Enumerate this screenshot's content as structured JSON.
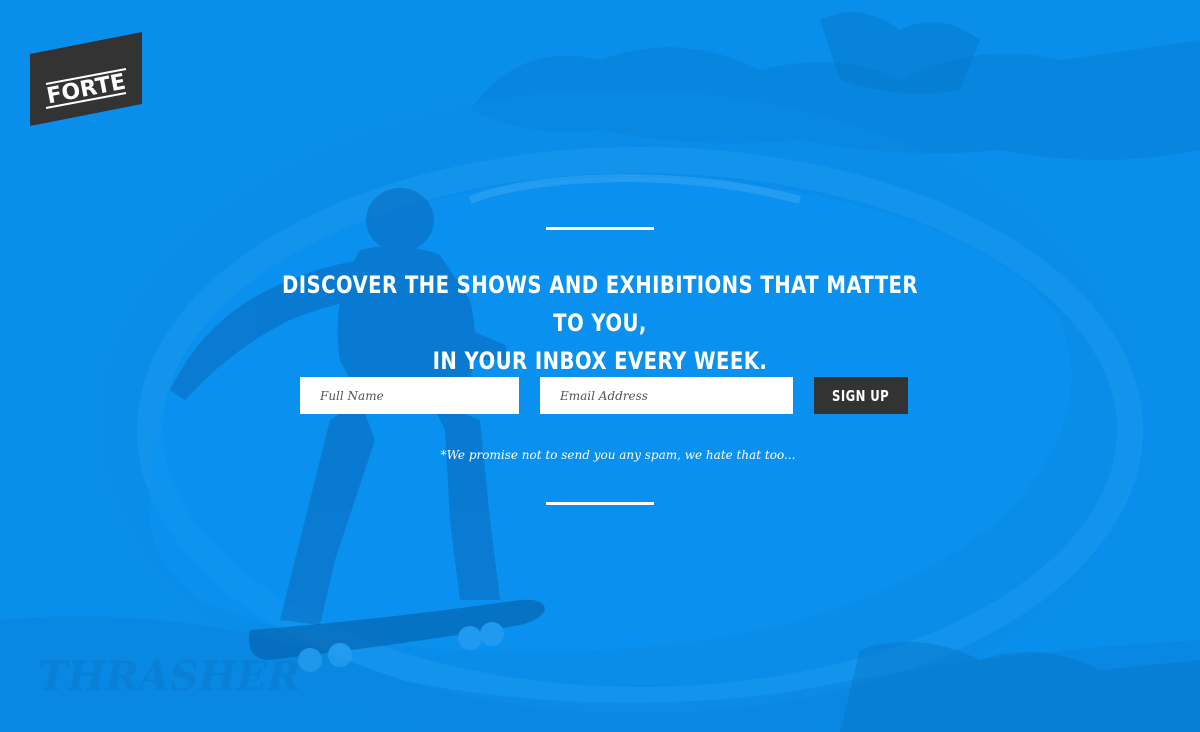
{
  "brand": {
    "name": "FORTE",
    "background_color": "#0a8eec",
    "logo_color": "#333333"
  },
  "hero": {
    "headline_line1": "DISCOVER THE SHOWS AND EXHIBITIONS THAT MATTER TO YOU,",
    "headline_line2": "IN YOUR INBOX EVERY WEEK."
  },
  "form": {
    "name_placeholder": "Full Name",
    "name_value": "",
    "email_placeholder": "Email Address",
    "email_value": "",
    "submit_label": "SIGN UP",
    "disclaimer": "*We promise not to send you any spam, we hate that too..."
  },
  "background": {
    "watermark_text": "THRASHER",
    "description_icon": "skateboard-bowl-photo"
  }
}
